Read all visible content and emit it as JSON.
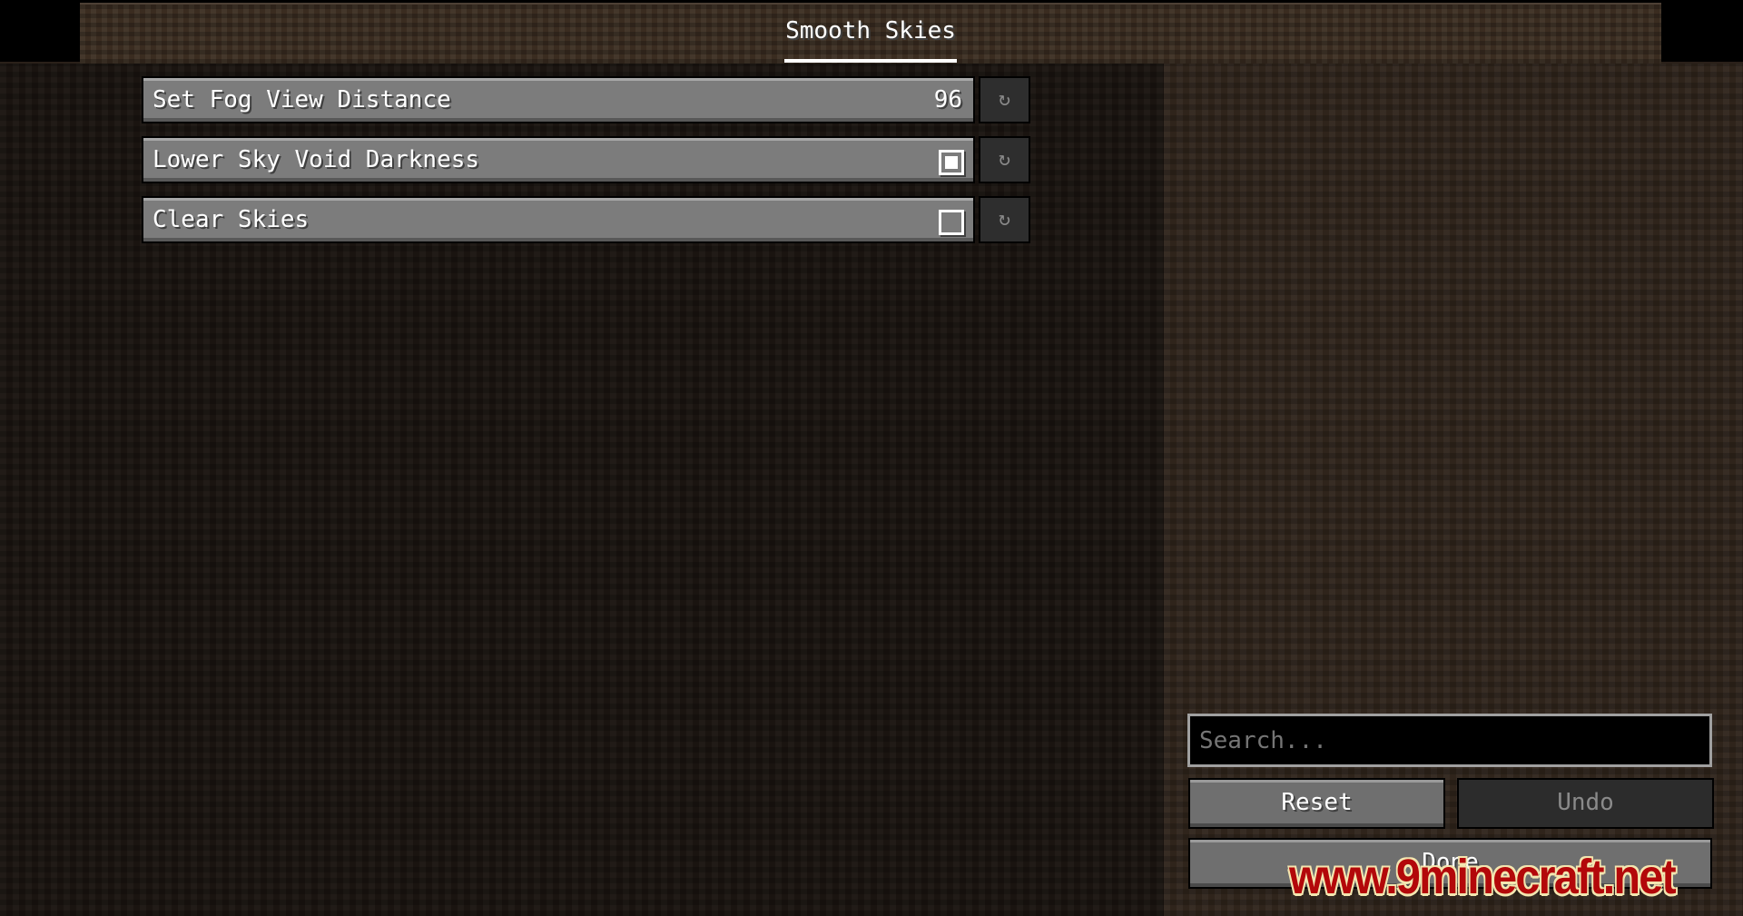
{
  "header": {
    "title": "Smooth Skies"
  },
  "options": [
    {
      "label": "Set Fog View Distance",
      "type": "slider",
      "value": "96",
      "reset_icon": "reset-icon"
    },
    {
      "label": "Lower Sky Void Darkness",
      "type": "checkbox",
      "checked": true,
      "reset_icon": "reset-icon"
    },
    {
      "label": "Clear Skies",
      "type": "checkbox",
      "checked": false,
      "reset_icon": "reset-icon"
    }
  ],
  "reset_glyph": "↻",
  "search": {
    "placeholder": "Search..."
  },
  "buttons": {
    "reset": "Reset",
    "undo": "Undo",
    "done": "Done"
  },
  "watermark": "www.9minecraft.net"
}
